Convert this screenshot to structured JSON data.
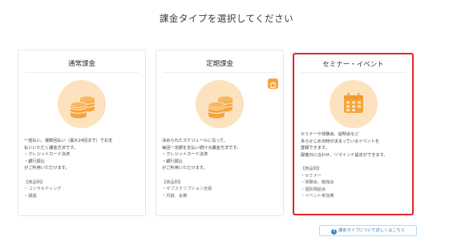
{
  "page_title": "課金タイプを選択してください",
  "cards": [
    {
      "title": "通常課金",
      "icon": "coins-icon",
      "description": [
        "一括払い、複数回払い（最大24回まで）でお支",
        "払いいただく課金方法です。",
        "・クレジットカード決済",
        "・銀行振込",
        "がご利用いただけます。"
      ],
      "examples_label": "【商品例】",
      "examples": [
        "・コンサルティング",
        "・講座"
      ],
      "selected": false
    },
    {
      "title": "定期課金",
      "icon": "coins-icon",
      "badge_icon": "sync-icon",
      "description": [
        "決められたスケジュールに沿って、",
        "毎回一定額を支払い続ける課金方法です。",
        "・クレジットカード決済",
        "・銀行振込",
        "がご利用いただけます。"
      ],
      "examples_label": "【商品例】",
      "examples": [
        "・サブスクリプション全般",
        "・月謝、会費"
      ],
      "selected": false
    },
    {
      "title": "セミナー・イベント",
      "icon": "calendar-icon",
      "description": [
        "セミナーや体験会、説明会など",
        "あらかじめ日時が決まっているイベントを",
        "登録できます。",
        "開催日に合わせ、リマインド設定ができます。"
      ],
      "examples_label": "【商品例】",
      "examples": [
        "・セミナー",
        "・体験会、勉強会",
        "・個別相談会",
        "・イベント参加費"
      ],
      "selected": true
    }
  ],
  "help_link": {
    "label": "課金タイプについて詳しくはこちら",
    "icon": "question-icon"
  },
  "colors": {
    "accent_orange": "#f6a43a",
    "icon_bg": "#fde2bf",
    "selected_border": "#e0262c",
    "link_blue": "#3b86c6"
  }
}
